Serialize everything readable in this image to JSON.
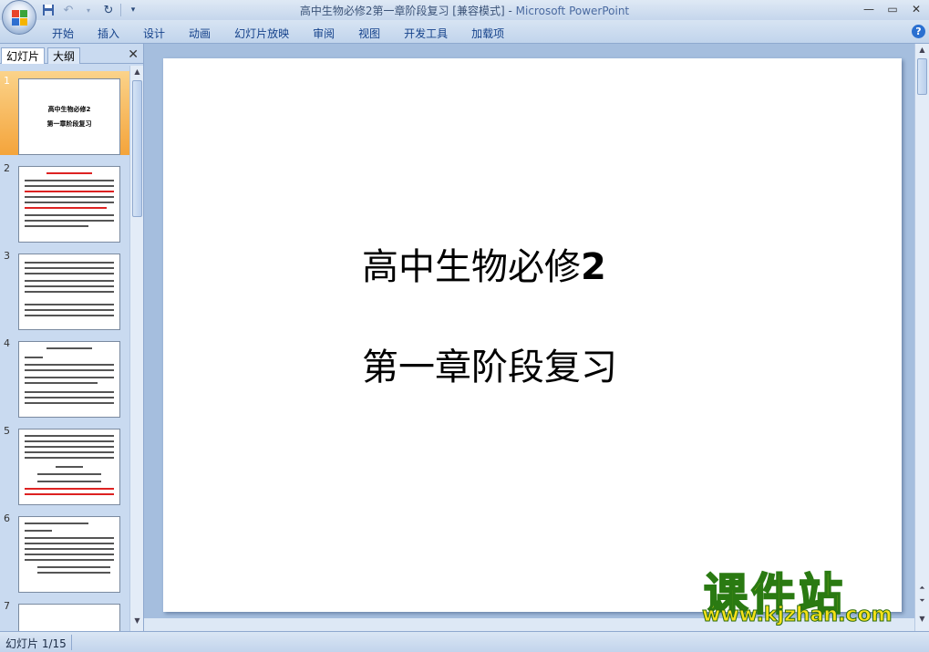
{
  "window": {
    "title_doc": "高中生物必修2第一章阶段复习 [兼容模式]",
    "title_sep": " - ",
    "title_app": "Microsoft PowerPoint"
  },
  "ribbon": {
    "tabs": [
      "开始",
      "插入",
      "设计",
      "动画",
      "幻灯片放映",
      "审阅",
      "视图",
      "开发工具",
      "加载项"
    ]
  },
  "left_pane": {
    "tab_slides": "幻灯片",
    "tab_outline": "大纲",
    "thumbnails": [
      {
        "num": "1",
        "line1": "高中生物必修2",
        "line2": "第一章阶段复习"
      },
      {
        "num": "2"
      },
      {
        "num": "3"
      },
      {
        "num": "4"
      },
      {
        "num": "5"
      },
      {
        "num": "6"
      },
      {
        "num": "7"
      }
    ]
  },
  "slide": {
    "line1_text": "高中生物必修",
    "line1_num": "2",
    "line2": "第一章阶段复习"
  },
  "watermark": {
    "text": "课件站",
    "url": "www.kjzhan.com"
  },
  "statusbar": {
    "slide_info": "幻灯片 1/15"
  },
  "colors": {
    "ribbon_text": "#15428b",
    "selected_thumb": "#f4a43b",
    "watermark_fill": "#f7e11a",
    "watermark_stroke": "#2a7a12"
  }
}
